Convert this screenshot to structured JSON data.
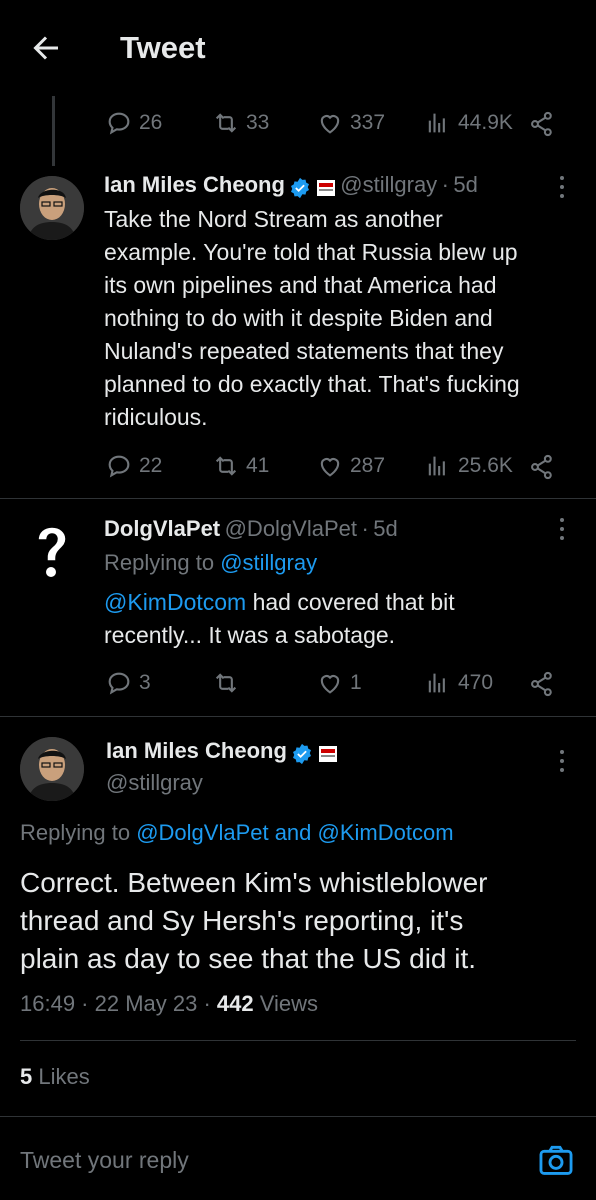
{
  "header": {
    "title": "Tweet"
  },
  "top_actions": {
    "replies": "26",
    "retweets": "33",
    "likes": "337",
    "views": "44.9K"
  },
  "tweet1": {
    "name": "Ian Miles Cheong",
    "handle": "@stillgray",
    "dot": "·",
    "time": "5d",
    "lines": [
      "Take the Nord Stream as another",
      "example. You're told that Russia blew up",
      "its own pipelines and that America had",
      "nothing to do with it despite Biden and",
      "Nuland's repeated statements that they",
      "planned to do exactly that. That's fucking",
      "ridiculous."
    ],
    "replies": "22",
    "retweets": "41",
    "likes": "287",
    "views": "25.6K"
  },
  "tweet2": {
    "name": "DolgVlaPet",
    "handle": "@DolgVlaPet",
    "dot": "·",
    "time": "5d",
    "replying_prefix": "Replying to",
    "replying_to": "@stillgray",
    "mention": "@KimDotcom",
    "line1_rest": " had covered that bit",
    "line2": "recently... It was a sabotage.",
    "replies": "3",
    "retweets": "",
    "likes": "1",
    "views": "470"
  },
  "main_tweet": {
    "name": "Ian Miles Cheong",
    "handle": "@stillgray",
    "replying_prefix": "Replying to ",
    "replying_to": "@DolgVlaPet and @KimDotcom",
    "lines": [
      "Correct. Between Kim's whistleblower",
      "thread and Sy Hersh's reporting, it's",
      "plain as day to see that the US did it."
    ],
    "timestamp": "16:49 · 22 May 23 · ",
    "views_count": "442",
    "views_label": " Views"
  },
  "likes_row": {
    "count": "5",
    "label": " Likes"
  },
  "reply_bar": {
    "placeholder": "Tweet your reply"
  },
  "colors": {
    "accent": "#1d9bf0",
    "muted": "#71767b",
    "background": "#000000",
    "text": "#e7e9ea"
  }
}
